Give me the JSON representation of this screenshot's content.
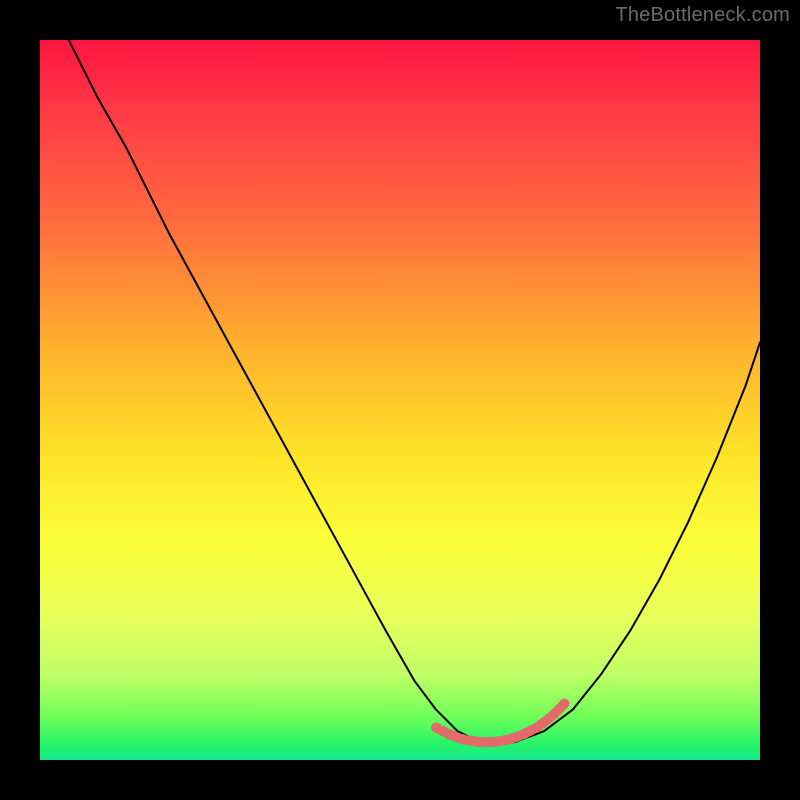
{
  "watermark": "TheBottleneck.com",
  "chart_data": {
    "type": "line",
    "title": "",
    "xlabel": "",
    "ylabel": "",
    "xlim": [
      0,
      100
    ],
    "ylim": [
      0,
      100
    ],
    "series": [
      {
        "name": "black-curve",
        "color": "#000000",
        "width": 2,
        "x": [
          4,
          8,
          12,
          18,
          24,
          30,
          36,
          42,
          48,
          52,
          55,
          58,
          61,
          63,
          66,
          70,
          74,
          78,
          82,
          86,
          90,
          94,
          98,
          100
        ],
        "y": [
          100,
          92,
          85,
          73,
          62,
          51,
          40,
          29,
          18,
          11,
          7,
          4,
          2.5,
          2,
          2.5,
          4,
          7,
          12,
          18,
          25,
          33,
          42,
          52,
          58
        ]
      },
      {
        "name": "pink-flat-segment",
        "color": "#e26a6a",
        "width": 10,
        "dash": [
          3,
          4
        ],
        "x": [
          55,
          57,
          59,
          61,
          63,
          65,
          67,
          69,
          71,
          73
        ],
        "y": [
          4.5,
          3.5,
          2.8,
          2.5,
          2.5,
          2.8,
          3.5,
          4.5,
          6.0,
          8.0
        ]
      }
    ]
  }
}
